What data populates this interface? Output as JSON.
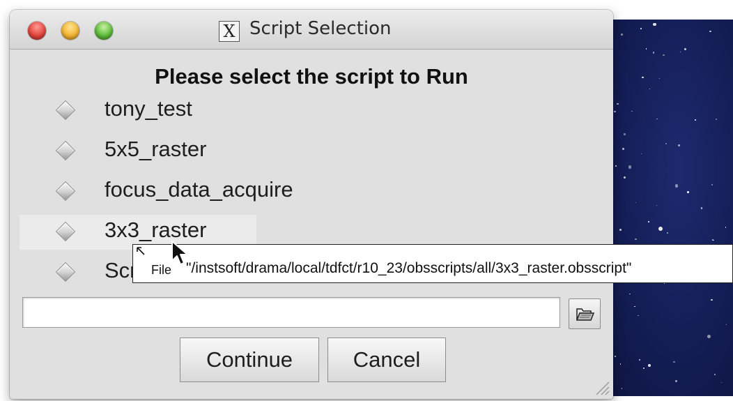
{
  "window": {
    "title": "Script Selection",
    "app_icon": "x11-logo-icon",
    "x_glyph": "X",
    "controls": [
      "close",
      "minimize",
      "zoom"
    ]
  },
  "dialog": {
    "heading": "Please select the script to Run",
    "options": [
      {
        "label": "tony_test",
        "selected": false
      },
      {
        "label": "5x5_raster",
        "selected": false
      },
      {
        "label": "focus_data_acquire",
        "selected": false
      },
      {
        "label": "3x3_raster",
        "selected": false,
        "hovered": true
      },
      {
        "label": "Scr",
        "selected": false
      }
    ],
    "path_input": {
      "value": "",
      "placeholder": ""
    },
    "browse_icon": "folder-open-icon",
    "buttons": {
      "continue": "Continue",
      "cancel": "Cancel"
    }
  },
  "tooltip": {
    "key": "File",
    "value": "\"/instsoft/drama/local/tdfct/r10_23/obsscripts/all/3x3_raster.obsscript\""
  },
  "colors": {
    "window_bg": "#e0e0e0",
    "desktop_bg": "#141d55",
    "close": "#e2463c",
    "minimize": "#f2b532",
    "zoom": "#5ebd3b"
  }
}
